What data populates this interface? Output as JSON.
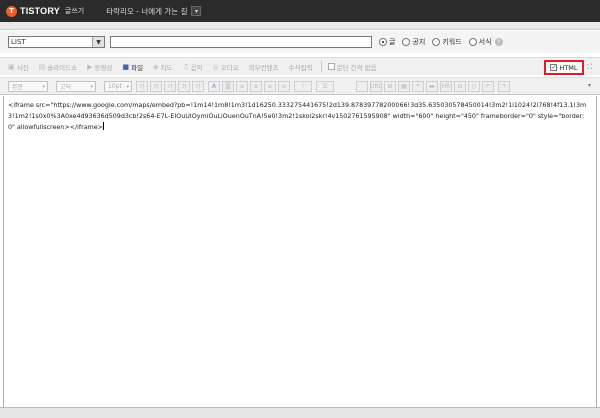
{
  "header": {
    "logo_mark": "T",
    "logo_text": "TISTORY",
    "logo_sub": "글쓰기",
    "blog_title": "타락리오 - 너에게 가는 길",
    "blog_dropdown_icon": "chevron-down-icon"
  },
  "post": {
    "category_value": "LIST",
    "title_value": "",
    "post_types": [
      {
        "label": "글",
        "selected": true
      },
      {
        "label": "공지",
        "selected": false
      },
      {
        "label": "키워드",
        "selected": false
      },
      {
        "label": "서식",
        "selected": false
      }
    ],
    "help_icon_text": "?"
  },
  "toolbar1": {
    "items": [
      {
        "icon": "▣",
        "label": "사진",
        "active": false
      },
      {
        "icon": "▤",
        "label": "슬라이드쇼",
        "active": false
      },
      {
        "icon": "▶",
        "label": "동영상",
        "active": false
      },
      {
        "icon": "■",
        "label": "파일",
        "active": true
      },
      {
        "icon": "◈",
        "label": "지도",
        "active": false
      },
      {
        "icon": "♫",
        "label": "음악",
        "active": false
      },
      {
        "icon": "◎",
        "label": "오디오",
        "active": false
      },
      {
        "icon": "",
        "label": "외부컨텐츠",
        "active": false
      },
      {
        "icon": "",
        "label": "수식입력",
        "active": false
      }
    ],
    "paragraph_spacing_label": "문단 간격 없음",
    "html_label": "HTML",
    "html_checked": true,
    "expand_icon": "⛶"
  },
  "toolbar2": {
    "paragraph_style": "본문",
    "font_family": "고딕",
    "font_size": "10pt",
    "buttons": [
      "가",
      "가",
      "가",
      "가",
      "가",
      "A",
      "▒",
      "≡",
      "≡",
      "≡",
      "≡",
      "⊤",
      "☰",
      "",
      "URL",
      "⊞",
      "▦",
      "❝",
      "▬",
      "HR",
      "⊟",
      "⟨⟩",
      "↶",
      "↷"
    ],
    "more_icon": "▾"
  },
  "editor": {
    "content": "<iframe src=\"https://www.google.com/maps/embed?pb=!1m14!1m8!1m3!1d16250.333275441675!2d139.87839778200066!3d35.635030578450014!3m2!1i1024!2i768!4f13.1!3m3!1m2!1s0x0%3A0xe4d93636d509d3cb!2s64-E7L-EIOuUIOymiOuLiOuenOuTnA!5e0!3m2!1skol2skr!4v1502761595908\" width=\"600\" height=\"450\" frameborder=\"0\" style=\"border:0\" allowfullscreen></iframe>"
  }
}
